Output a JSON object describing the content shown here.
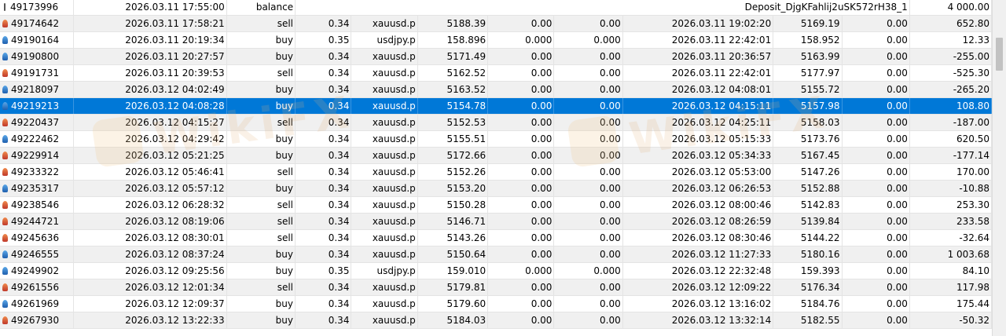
{
  "watermark_text": "WikiFX",
  "rows": [
    {
      "icon": "balance-icon",
      "ticket": "49173996",
      "open_time": "2026.03.11 17:55:00",
      "type": "balance",
      "comment": "Deposit_DjgKFahlij2uSK572rH38_1",
      "profit": "4 000.00"
    },
    {
      "icon": "sell-icon",
      "ticket": "49174642",
      "open_time": "2026.03.11 17:58:21",
      "type": "sell",
      "volume": "0.34",
      "symbol": "xauusd.p",
      "price": "5188.39",
      "sl": "0.00",
      "tp": "0.00",
      "close_time": "2026.03.11 19:02:20",
      "close_price": "5169.19",
      "swap": "0.00",
      "profit": "652.80"
    },
    {
      "icon": "buy-icon",
      "ticket": "49190164",
      "open_time": "2026.03.11 20:19:34",
      "type": "buy",
      "volume": "0.35",
      "symbol": "usdjpy.p",
      "price": "158.896",
      "sl": "0.000",
      "tp": "0.000",
      "close_time": "2026.03.11 22:42:01",
      "close_price": "158.952",
      "swap": "0.00",
      "profit": "12.33"
    },
    {
      "icon": "buy-icon",
      "ticket": "49190800",
      "open_time": "2026.03.11 20:27:57",
      "type": "buy",
      "volume": "0.34",
      "symbol": "xauusd.p",
      "price": "5171.49",
      "sl": "0.00",
      "tp": "0.00",
      "close_time": "2026.03.11 20:36:57",
      "close_price": "5163.99",
      "swap": "0.00",
      "profit": "-255.00"
    },
    {
      "icon": "sell-icon",
      "ticket": "49191731",
      "open_time": "2026.03.11 20:39:53",
      "type": "sell",
      "volume": "0.34",
      "symbol": "xauusd.p",
      "price": "5162.52",
      "sl": "0.00",
      "tp": "0.00",
      "close_time": "2026.03.11 22:42:01",
      "close_price": "5177.97",
      "swap": "0.00",
      "profit": "-525.30"
    },
    {
      "icon": "buy-icon",
      "ticket": "49218097",
      "open_time": "2026.03.12 04:02:49",
      "type": "buy",
      "volume": "0.34",
      "symbol": "xauusd.p",
      "price": "5163.52",
      "sl": "0.00",
      "tp": "0.00",
      "close_time": "2026.03.12 04:08:01",
      "close_price": "5155.72",
      "swap": "0.00",
      "profit": "-265.20"
    },
    {
      "icon": "buy-icon",
      "ticket": "49219213",
      "open_time": "2026.03.12 04:08:28",
      "type": "buy",
      "volume": "0.34",
      "symbol": "xauusd.p",
      "price": "5154.78",
      "sl": "0.00",
      "tp": "0.00",
      "close_time": "2026.03.12 04:15:11",
      "close_price": "5157.98",
      "swap": "0.00",
      "profit": "108.80",
      "selected": true
    },
    {
      "icon": "sell-icon",
      "ticket": "49220437",
      "open_time": "2026.03.12 04:15:27",
      "type": "sell",
      "volume": "0.34",
      "symbol": "xauusd.p",
      "price": "5152.53",
      "sl": "0.00",
      "tp": "0.00",
      "close_time": "2026.03.12 04:25:11",
      "close_price": "5158.03",
      "swap": "0.00",
      "profit": "-187.00"
    },
    {
      "icon": "buy-icon",
      "ticket": "49222462",
      "open_time": "2026.03.12 04:29:42",
      "type": "buy",
      "volume": "0.34",
      "symbol": "xauusd.p",
      "price": "5155.51",
      "sl": "0.00",
      "tp": "0.00",
      "close_time": "2026.03.12 05:15:33",
      "close_price": "5173.76",
      "swap": "0.00",
      "profit": "620.50"
    },
    {
      "icon": "sell-icon",
      "ticket": "49229914",
      "open_time": "2026.03.12 05:21:25",
      "type": "buy",
      "volume": "0.34",
      "symbol": "xauusd.p",
      "price": "5172.66",
      "sl": "0.00",
      "tp": "0.00",
      "close_time": "2026.03.12 05:34:33",
      "close_price": "5167.45",
      "swap": "0.00",
      "profit": "-177.14"
    },
    {
      "icon": "sell-icon",
      "ticket": "49233322",
      "open_time": "2026.03.12 05:46:41",
      "type": "sell",
      "volume": "0.34",
      "symbol": "xauusd.p",
      "price": "5152.26",
      "sl": "0.00",
      "tp": "0.00",
      "close_time": "2026.03.12 05:53:00",
      "close_price": "5147.26",
      "swap": "0.00",
      "profit": "170.00"
    },
    {
      "icon": "buy-icon",
      "ticket": "49235317",
      "open_time": "2026.03.12 05:57:12",
      "type": "buy",
      "volume": "0.34",
      "symbol": "xauusd.p",
      "price": "5153.20",
      "sl": "0.00",
      "tp": "0.00",
      "close_time": "2026.03.12 06:26:53",
      "close_price": "5152.88",
      "swap": "0.00",
      "profit": "-10.88"
    },
    {
      "icon": "sell-icon",
      "ticket": "49238546",
      "open_time": "2026.03.12 06:28:32",
      "type": "sell",
      "volume": "0.34",
      "symbol": "xauusd.p",
      "price": "5150.28",
      "sl": "0.00",
      "tp": "0.00",
      "close_time": "2026.03.12 08:00:46",
      "close_price": "5142.83",
      "swap": "0.00",
      "profit": "253.30"
    },
    {
      "icon": "sell-icon",
      "ticket": "49244721",
      "open_time": "2026.03.12 08:19:06",
      "type": "sell",
      "volume": "0.34",
      "symbol": "xauusd.p",
      "price": "5146.71",
      "sl": "0.00",
      "tp": "0.00",
      "close_time": "2026.03.12 08:26:59",
      "close_price": "5139.84",
      "swap": "0.00",
      "profit": "233.58"
    },
    {
      "icon": "sell-icon",
      "ticket": "49245636",
      "open_time": "2026.03.12 08:30:01",
      "type": "sell",
      "volume": "0.34",
      "symbol": "xauusd.p",
      "price": "5143.26",
      "sl": "0.00",
      "tp": "0.00",
      "close_time": "2026.03.12 08:30:46",
      "close_price": "5144.22",
      "swap": "0.00",
      "profit": "-32.64"
    },
    {
      "icon": "buy-icon",
      "ticket": "49246555",
      "open_time": "2026.03.12 08:37:24",
      "type": "buy",
      "volume": "0.34",
      "symbol": "xauusd.p",
      "price": "5150.64",
      "sl": "0.00",
      "tp": "0.00",
      "close_time": "2026.03.12 11:27:33",
      "close_price": "5180.16",
      "swap": "0.00",
      "profit": "1 003.68"
    },
    {
      "icon": "buy-icon",
      "ticket": "49249902",
      "open_time": "2026.03.12 09:25:56",
      "type": "buy",
      "volume": "0.35",
      "symbol": "usdjpy.p",
      "price": "159.010",
      "sl": "0.000",
      "tp": "0.000",
      "close_time": "2026.03.12 22:32:48",
      "close_price": "159.393",
      "swap": "0.00",
      "profit": "84.10"
    },
    {
      "icon": "sell-icon",
      "ticket": "49261556",
      "open_time": "2026.03.12 12:01:34",
      "type": "sell",
      "volume": "0.34",
      "symbol": "xauusd.p",
      "price": "5179.81",
      "sl": "0.00",
      "tp": "0.00",
      "close_time": "2026.03.12 12:09:22",
      "close_price": "5176.34",
      "swap": "0.00",
      "profit": "117.98"
    },
    {
      "icon": "buy-icon",
      "ticket": "49261969",
      "open_time": "2026.03.12 12:09:37",
      "type": "buy",
      "volume": "0.34",
      "symbol": "xauusd.p",
      "price": "5179.60",
      "sl": "0.00",
      "tp": "0.00",
      "close_time": "2026.03.12 13:16:02",
      "close_price": "5184.76",
      "swap": "0.00",
      "profit": "175.44"
    },
    {
      "icon": "sell-icon",
      "ticket": "49267930",
      "open_time": "2026.03.12 13:22:33",
      "type": "buy",
      "volume": "0.34",
      "symbol": "xauusd.p",
      "price": "5184.03",
      "sl": "0.00",
      "tp": "0.00",
      "close_time": "2026.03.12 13:32:14",
      "close_price": "5182.55",
      "swap": "0.00",
      "profit": "-50.32"
    }
  ]
}
